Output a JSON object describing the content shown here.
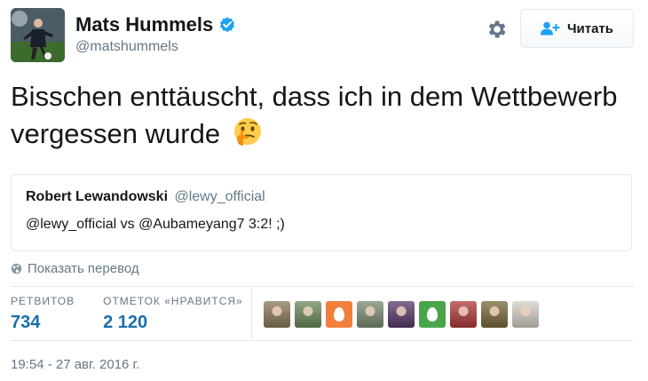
{
  "author": {
    "display_name": "Mats Hummels",
    "handle": "@matshummels",
    "avatar_icon": "player-avatar",
    "verified": true
  },
  "actions": {
    "settings_icon": "gear-icon",
    "follow_label": "Читать",
    "follow_icon": "add-user-icon"
  },
  "tweet": {
    "text": "Bisschen enttäuscht, dass ich in dem Wettbewerb vergessen wurde",
    "emoji": "thinking-face"
  },
  "quoted": {
    "display_name": "Robert Lewandowski",
    "handle": "@lewy_official",
    "text": "@lewy_official vs @Aubameyang7 3:2! ;)"
  },
  "translate": {
    "label": "Показать перевод",
    "icon": "globe-icon"
  },
  "stats": {
    "retweets_label": "РЕТВИТОВ",
    "retweets_value": "734",
    "likes_label": "ОТМЕТОК «НРАВИТСЯ»",
    "likes_value": "2 120"
  },
  "likers": [
    {
      "type": "photo",
      "color": "#8a7a5a"
    },
    {
      "type": "photo",
      "color": "#6b8a5a"
    },
    {
      "type": "egg",
      "color": "#f0803c"
    },
    {
      "type": "photo",
      "color": "#7c8c74"
    },
    {
      "type": "photo",
      "color": "#5a3a6a"
    },
    {
      "type": "egg",
      "color": "#4aa54a"
    },
    {
      "type": "photo",
      "color": "#b03a3a"
    },
    {
      "type": "photo",
      "color": "#7a6a3a"
    },
    {
      "type": "photo",
      "color": "#d8d0c8"
    }
  ],
  "timestamp": "19:54 - 27 авг. 2016 г.",
  "colors": {
    "link_blue": "#1b6ea8",
    "muted": "#657786",
    "border": "#e1e8ed",
    "verified_blue": "#1da1f2"
  }
}
